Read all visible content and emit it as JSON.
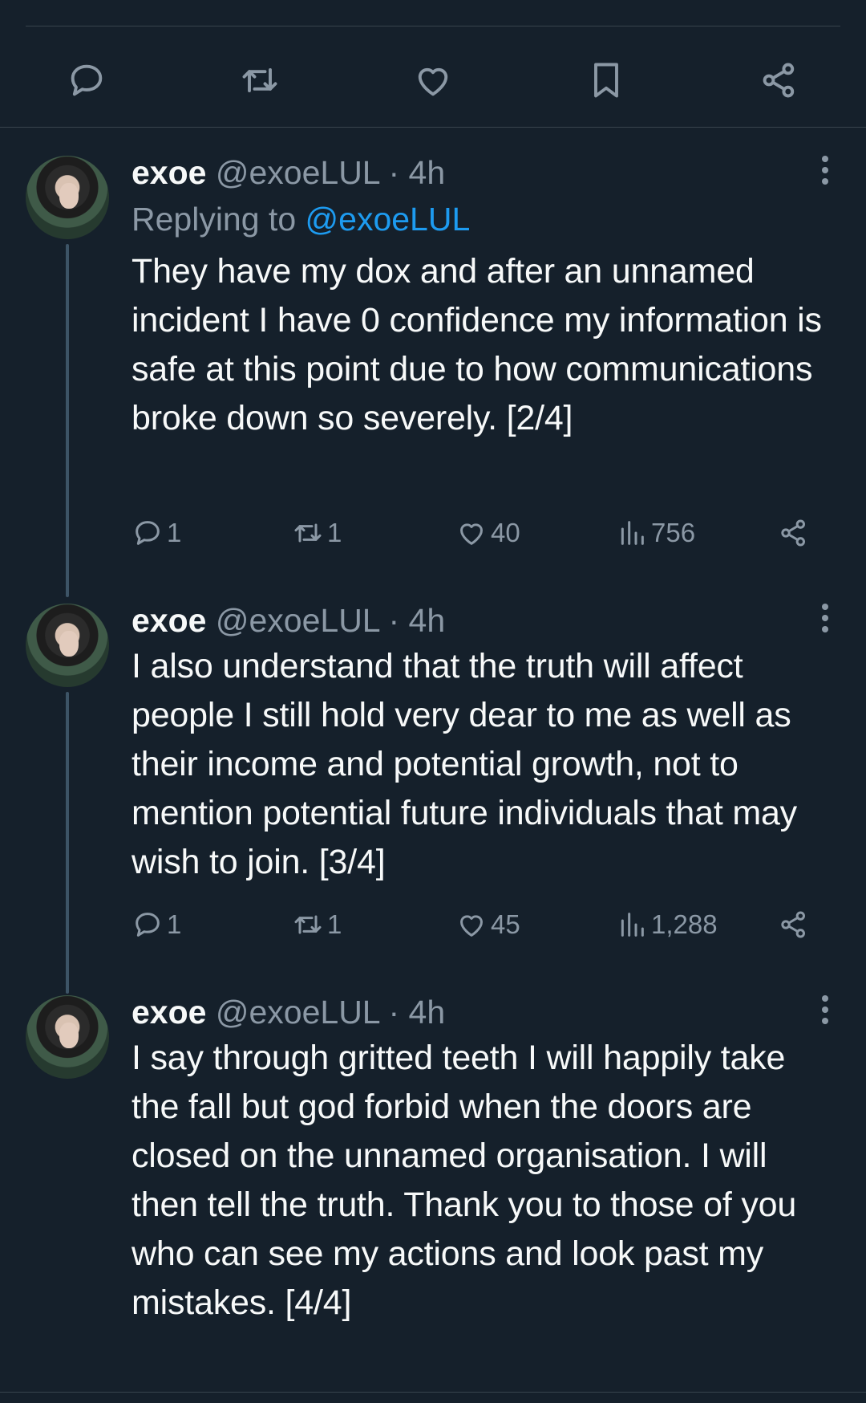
{
  "action_bar": {
    "icons": [
      "reply-icon",
      "retweet-icon",
      "like-icon",
      "bookmark-icon",
      "share-icon"
    ]
  },
  "tweets": [
    {
      "name": "exoe",
      "handle": "@exoeLUL",
      "time": "· 4h",
      "replying_prefix": "Replying to",
      "replying_to": "@exoeLUL",
      "text": "They have my dox and after an unnamed incident I have 0 confidence my information is safe at this point due to how communications broke down so severely. [2/4]",
      "replies": "1",
      "retweets": "1",
      "likes": "40",
      "views": "756"
    },
    {
      "name": "exoe",
      "handle": "@exoeLUL",
      "time": "· 4h",
      "text": "I also understand that the truth will affect people I still hold very dear to me as well as their income and potential growth, not to mention potential future individuals that may wish to join. [3/4]",
      "replies": "1",
      "retweets": "1",
      "likes": "45",
      "views": "1,288"
    },
    {
      "name": "exoe",
      "handle": "@exoeLUL",
      "time": "· 4h",
      "text": "I say through gritted teeth I will happily take the fall but god forbid when the doors are closed on the unnamed organisation. I will then tell the truth. Thank you to those of you who can see my actions and look past my mistakes. [4/4]"
    }
  ],
  "colors": {
    "background": "#15202b",
    "text": "#f7f9f9",
    "muted": "#8b98a5",
    "accent": "#1d9bf0",
    "divider": "#38444d"
  }
}
